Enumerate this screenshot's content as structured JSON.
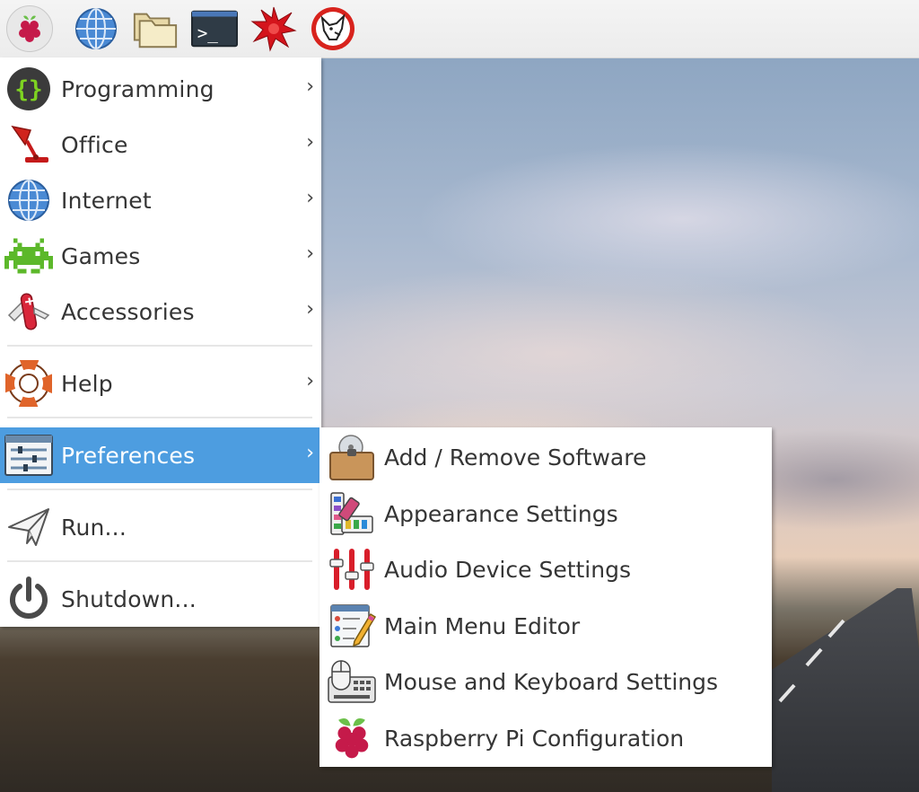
{
  "panel": {
    "launchers": [
      {
        "name": "menu",
        "icon": "raspberry-icon"
      },
      {
        "name": "web-browser",
        "icon": "globe-icon"
      },
      {
        "name": "file-manager",
        "icon": "folders-icon"
      },
      {
        "name": "terminal",
        "icon": "terminal-icon"
      },
      {
        "name": "mathematica",
        "icon": "red-star-icon"
      },
      {
        "name": "wolfram",
        "icon": "wolf-icon"
      }
    ],
    "terminal_prompt": ">_"
  },
  "main_menu": {
    "items": [
      {
        "label": "Programming",
        "icon": "code-braces-icon",
        "has_submenu": true
      },
      {
        "label": "Office",
        "icon": "desk-lamp-icon",
        "has_submenu": true
      },
      {
        "label": "Internet",
        "icon": "globe-icon",
        "has_submenu": true
      },
      {
        "label": "Games",
        "icon": "space-invader-icon",
        "has_submenu": true
      },
      {
        "label": "Accessories",
        "icon": "pocket-knife-icon",
        "has_submenu": true
      },
      {
        "label": "Help",
        "icon": "lifebuoy-icon",
        "has_submenu": true
      },
      {
        "label": "Preferences",
        "icon": "settings-sliders-icon",
        "has_submenu": true,
        "active": true
      },
      {
        "label": "Run...",
        "icon": "paper-plane-icon",
        "has_submenu": false
      },
      {
        "label": "Shutdown...",
        "icon": "power-icon",
        "has_submenu": false
      }
    ],
    "chevron": "›"
  },
  "preferences_submenu": {
    "items": [
      {
        "label": "Add / Remove Software",
        "icon": "software-package-icon"
      },
      {
        "label": "Appearance Settings",
        "icon": "color-palette-icon"
      },
      {
        "label": "Audio Device Settings",
        "icon": "audio-mixer-icon"
      },
      {
        "label": "Main Menu Editor",
        "icon": "menu-editor-icon"
      },
      {
        "label": "Mouse and Keyboard Settings",
        "icon": "mouse-keyboard-icon"
      },
      {
        "label": "Raspberry Pi Configuration",
        "icon": "raspberry-icon"
      }
    ]
  },
  "colors": {
    "highlight": "#4d9de0",
    "raspberry_red": "#c51a4a",
    "leaf_green": "#6cc04a"
  }
}
